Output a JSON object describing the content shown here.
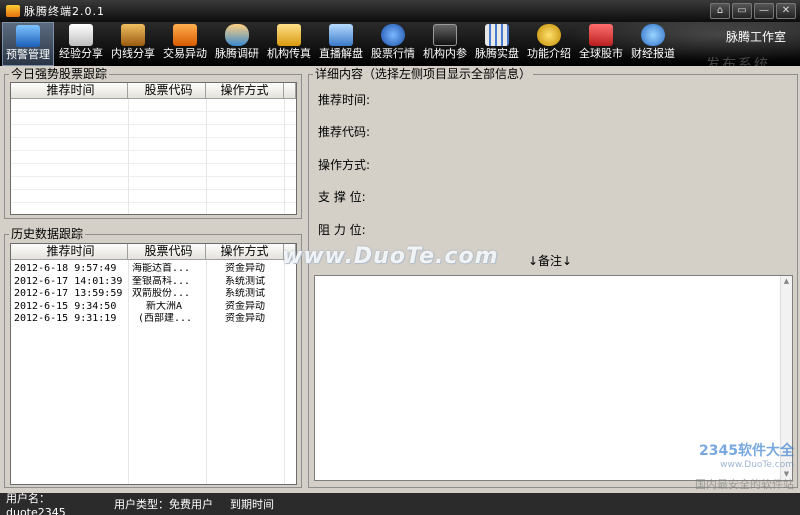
{
  "window": {
    "title": "脉腾终端2.0.1",
    "controls": [
      "⌂",
      "▭",
      "—",
      "✕"
    ]
  },
  "toolbar": {
    "items": [
      {
        "label": "预警管理",
        "icon": "monitor-icon",
        "color": "#2f7fd8",
        "active": true
      },
      {
        "label": "经验分享",
        "icon": "document-icon",
        "color": "#e8e8e8"
      },
      {
        "label": "内线分享",
        "icon": "door-icon",
        "color": "#c8901e"
      },
      {
        "label": "交易异动",
        "icon": "rss-icon",
        "color": "#ef7a12"
      },
      {
        "label": "脉腾调研",
        "icon": "people-icon",
        "color": "#4aa6d8"
      },
      {
        "label": "机构传真",
        "icon": "folder-icon",
        "color": "#f0b62e"
      },
      {
        "label": "直播解盘",
        "icon": "presentation-icon",
        "color": "#5b9ad6"
      },
      {
        "label": "股票行情",
        "icon": "globe-icon",
        "color": "#2e6fd6"
      },
      {
        "label": "机构内参",
        "icon": "terminal-icon",
        "color": "#444444"
      },
      {
        "label": "脉腾实盘",
        "icon": "store-icon",
        "color": "#d8d8d8"
      },
      {
        "label": "功能介绍",
        "icon": "coins-icon",
        "color": "#e5b51d"
      },
      {
        "label": "全球股市",
        "icon": "mail-icon",
        "color": "#dd2b2b"
      },
      {
        "label": "财经报道",
        "icon": "world-icon",
        "color": "#3a8ae0"
      }
    ],
    "studio": "脉腾工作室",
    "banner": "发布系统"
  },
  "today_panel": {
    "title": "今日强势股票跟踪",
    "columns": [
      "推荐时间",
      "股票代码",
      "操作方式"
    ],
    "rows": []
  },
  "history_panel": {
    "title": "历史数据跟踪",
    "columns": [
      "推荐时间",
      "股票代码",
      "操作方式"
    ],
    "rows": [
      [
        "2012-6-18 9:57:49",
        "海能达首...",
        "资金异动"
      ],
      [
        "2012-6-17 14:01:39",
        "奎银高科...",
        "系统测试"
      ],
      [
        "2012-6-17 13:59:59",
        "双箭股份...",
        "系统测试"
      ],
      [
        "2012-6-15 9:34:50",
        "新大洲A",
        "资金异动"
      ],
      [
        "2012-6-15 9:31:19",
        "(西部建...",
        "资金异动"
      ]
    ]
  },
  "detail": {
    "title": "详细内容（选择左侧项目显示全部信息）",
    "fields": {
      "time": "推荐时间:",
      "code": "推荐代码:",
      "method": "操作方式:",
      "support": "支 撑 位:",
      "resistance": "阻 力 位:"
    },
    "remark_label": "↓备注↓"
  },
  "watermarks": {
    "duote": "www.DuoTe.com",
    "site_name": "2345软件大全",
    "site_url": "www.DuoTe.com",
    "slogan": "国内最安全的软件站"
  },
  "statusbar": {
    "user": "用户名：duote2345",
    "user_type": "用户类型：免费用户",
    "expire": "到期时间"
  }
}
